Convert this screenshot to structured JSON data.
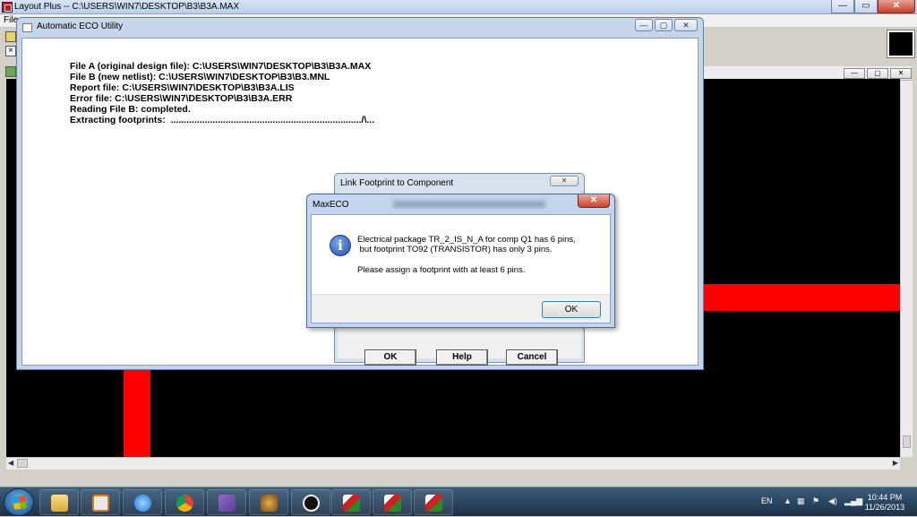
{
  "main_window": {
    "title": "Layout Plus -- C:\\USERS\\WIN7\\DESKTOP\\B3\\B3A.MAX",
    "menu_file": "File",
    "btn_min": "—",
    "btn_restore": "▭",
    "btn_close": "✕"
  },
  "eco_window": {
    "title": "Automatic ECO Utility",
    "btn_min": "—",
    "btn_max": "▢",
    "btn_close": "✕",
    "log": [
      "File A (original design file): C:\\USERS\\WIN7\\DESKTOP\\B3\\B3A.MAX",
      "File B (new netlist): C:\\USERS\\WIN7\\DESKTOP\\B3\\B3.MNL",
      "Report file: C:\\USERS\\WIN7\\DESKTOP\\B3\\B3A.LIS",
      "Error file: C:\\USERS\\WIN7\\DESKTOP\\B3\\B3A.ERR",
      "Reading File B: completed.",
      "Extracting footprints:  ........................................................................./\\..."
    ]
  },
  "link_dialog": {
    "title": "Link Footprint to Component",
    "close": "✕",
    "ok": "OK",
    "help": "Help",
    "cancel": "Cancel"
  },
  "message_box": {
    "title": "MaxECO",
    "close": "✕",
    "icon": "i",
    "line1": "Electrical package TR_2_IS_N_A for comp Q1 has 6 pins,",
    "line2": " but footprint TO92 (TRANSISTOR) has only 3 pins.",
    "line3": "Please assign a footprint with at least 6 pins.",
    "ok": "OK"
  },
  "canvas_window": {
    "btn_min": "—",
    "btn_max": "▢",
    "btn_close": "✕"
  },
  "taskbar": {
    "apps": [
      "explorer-icon",
      "media-player-icon",
      "internet-explorer-icon",
      "chrome-icon",
      "visual-studio-icon",
      "game-icon",
      "lettering-app-icon",
      "layout-plus-icon",
      "layout-plus-icon",
      "layout-plus-icon"
    ],
    "language": "EN",
    "time": "10:44 PM",
    "date": "11/26/2013"
  },
  "colors": {
    "canvas": "#000000",
    "trace": "#ff0000"
  }
}
